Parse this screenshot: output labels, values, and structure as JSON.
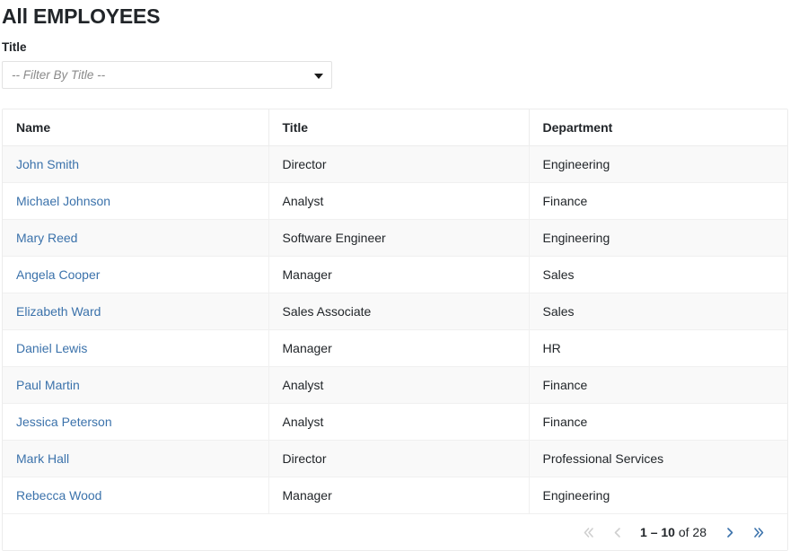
{
  "header": {
    "title": "All EMPLOYEES"
  },
  "filter": {
    "label": "Title",
    "placeholder": "-- Filter By Title --",
    "selected_value": "-- Filter By Title --",
    "caret_icon": "chevron-down-icon",
    "options": []
  },
  "table": {
    "columns": [
      "Name",
      "Title",
      "Department"
    ],
    "rows": [
      {
        "name": "John Smith",
        "title": "Director",
        "department": "Engineering"
      },
      {
        "name": "Michael Johnson",
        "title": "Analyst",
        "department": "Finance"
      },
      {
        "name": "Mary Reed",
        "title": "Software Engineer",
        "department": "Engineering"
      },
      {
        "name": "Angela Cooper",
        "title": "Manager",
        "department": "Sales"
      },
      {
        "name": "Elizabeth Ward",
        "title": "Sales Associate",
        "department": "Sales"
      },
      {
        "name": "Daniel Lewis",
        "title": "Manager",
        "department": "HR"
      },
      {
        "name": "Paul Martin",
        "title": "Analyst",
        "department": "Finance"
      },
      {
        "name": "Jessica Peterson",
        "title": "Analyst",
        "department": "Finance"
      },
      {
        "name": "Mark Hall",
        "title": "Director",
        "department": "Professional Services"
      },
      {
        "name": "Rebecca Wood",
        "title": "Manager",
        "department": "Engineering"
      }
    ]
  },
  "pagination": {
    "range_bold": "1 – 10",
    "range_rest": " of 28",
    "range_full": "1 – 10 of 28",
    "page_start": 1,
    "page_end": 10,
    "total": 28,
    "first_icon": "double-chevron-left-icon",
    "prev_icon": "chevron-left-icon",
    "next_icon": "chevron-right-icon",
    "last_icon": "double-chevron-right-icon",
    "first_enabled": false,
    "prev_enabled": false,
    "next_enabled": true,
    "last_enabled": true
  },
  "colors": {
    "link": "#3b72ab",
    "text": "#212529",
    "row_stripe": "#f9f9f9",
    "border": "#ececec",
    "disabled_arrow": "#cfcfcf",
    "placeholder": "#8a8a8a"
  }
}
